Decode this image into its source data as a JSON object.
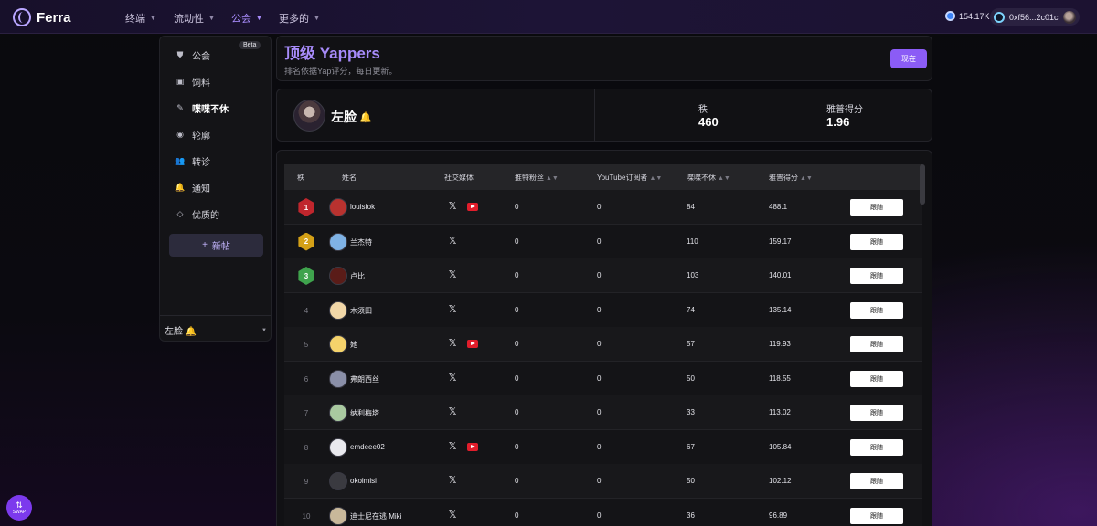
{
  "app": {
    "name": "Ferra"
  },
  "nav": [
    {
      "label": "终端",
      "active": false
    },
    {
      "label": "流动性",
      "active": false
    },
    {
      "label": "公会",
      "active": true
    },
    {
      "label": "更多的",
      "active": false
    }
  ],
  "account": {
    "balance": "154.17K",
    "wallet": "0xf56...2c01c"
  },
  "sidebar": {
    "badge": "Beta",
    "items": [
      {
        "label": "公会",
        "icon": "guild-icon"
      },
      {
        "label": "饲料",
        "icon": "feed-icon"
      },
      {
        "label": "喋喋不休",
        "icon": "yap-icon",
        "active": true
      },
      {
        "label": "轮廓",
        "icon": "profile-icon"
      },
      {
        "label": "转诊",
        "icon": "referral-icon"
      },
      {
        "label": "通知",
        "icon": "bell-icon"
      },
      {
        "label": "优质的",
        "icon": "diamond-icon"
      }
    ],
    "new_post": "新帖",
    "user": "左脸 🔔"
  },
  "header": {
    "title": "顶级 Yappers",
    "subtitle": "排名依据Yap评分，每日更新。",
    "button": "现在"
  },
  "profile": {
    "name": "左脸",
    "emoji": "🔔",
    "stats": [
      {
        "label": "秩",
        "value": "460"
      },
      {
        "label": "雅普得分",
        "value": "1.96"
      }
    ]
  },
  "table": {
    "headers": {
      "rank": "秩",
      "name": "姓名",
      "social": "社交媒体",
      "twitter_followers": "推特粉丝",
      "youtube_subscribers": "YouTube订阅者",
      "yaps": "喋喋不休",
      "yap_score": "雅普得分"
    },
    "follow_label": "跟随",
    "rows": [
      {
        "rank": "1",
        "name": "louisfok",
        "youtube": true,
        "twitter_followers": "0",
        "youtube_subscribers": "0",
        "yaps": "84",
        "yap_score": "488.1",
        "medal": "red",
        "avatar": "#b8322f"
      },
      {
        "rank": "2",
        "name": "兰杰特",
        "youtube": false,
        "twitter_followers": "0",
        "youtube_subscribers": "0",
        "yaps": "110",
        "yap_score": "159.17",
        "medal": "gold",
        "avatar": "#7fb2e5"
      },
      {
        "rank": "3",
        "name": "卢比",
        "youtube": false,
        "twitter_followers": "0",
        "youtube_subscribers": "0",
        "yaps": "103",
        "yap_score": "140.01",
        "medal": "bronze",
        "avatar": "#5a1c18"
      },
      {
        "rank": "4",
        "name": "木须田",
        "youtube": false,
        "twitter_followers": "0",
        "youtube_subscribers": "0",
        "yaps": "74",
        "yap_score": "135.14",
        "medal": "",
        "avatar": "#f1d7a8"
      },
      {
        "rank": "5",
        "name": "她",
        "youtube": true,
        "twitter_followers": "0",
        "youtube_subscribers": "0",
        "yaps": "57",
        "yap_score": "119.93",
        "medal": "",
        "avatar": "#f5d36b"
      },
      {
        "rank": "6",
        "name": "弗朗西丝",
        "youtube": false,
        "twitter_followers": "0",
        "youtube_subscribers": "0",
        "yaps": "50",
        "yap_score": "118.55",
        "medal": "",
        "avatar": "#8a8fa8"
      },
      {
        "rank": "7",
        "name": "纳利梅塔",
        "youtube": false,
        "twitter_followers": "0",
        "youtube_subscribers": "0",
        "yaps": "33",
        "yap_score": "113.02",
        "medal": "",
        "avatar": "#a9c9a0"
      },
      {
        "rank": "8",
        "name": "emdeee02",
        "youtube": true,
        "twitter_followers": "0",
        "youtube_subscribers": "0",
        "yaps": "67",
        "yap_score": "105.84",
        "medal": "",
        "avatar": "#e9e9ee"
      },
      {
        "rank": "9",
        "name": "okoimisi",
        "youtube": false,
        "twitter_followers": "0",
        "youtube_subscribers": "0",
        "yaps": "50",
        "yap_score": "102.12",
        "medal": "",
        "avatar": "#3a3a40"
      },
      {
        "rank": "10",
        "name": "迪士尼在逃 Miki",
        "youtube": false,
        "twitter_followers": "0",
        "youtube_subscribers": "0",
        "yaps": "36",
        "yap_score": "96.89",
        "medal": "",
        "avatar": "#c8b89a"
      }
    ]
  },
  "swap": {
    "label": "SWAP"
  },
  "colors": {
    "accent": "#8b5cf6",
    "title": "#a78bfa",
    "youtube": "#e11d2b"
  }
}
